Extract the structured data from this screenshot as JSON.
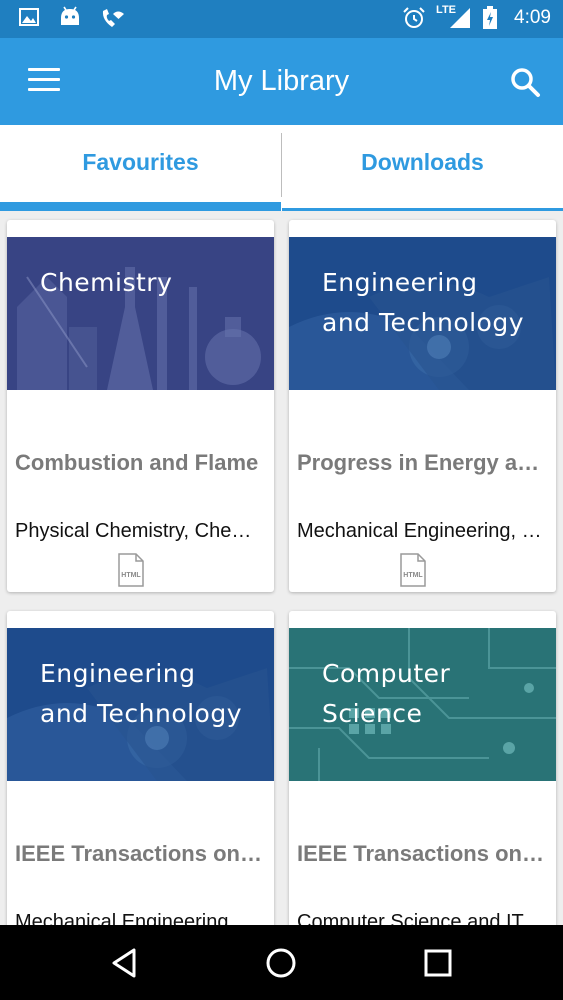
{
  "status_bar": {
    "time": "4:09",
    "network": "LTE",
    "left_icons": [
      "image-icon",
      "android-icon",
      "wifi-call-icon"
    ],
    "right_icons": [
      "alarm-icon",
      "signal-icon",
      "battery-icon"
    ]
  },
  "app_bar": {
    "title": "My Library",
    "menu_icon": "menu-icon",
    "search_icon": "search-icon"
  },
  "tabs": [
    {
      "label": "Favourites",
      "selected": true
    },
    {
      "label": "Downloads",
      "selected": false
    }
  ],
  "cards": [
    {
      "image_label_lines": [
        "Chemistry"
      ],
      "title": "Combustion and Flame",
      "subtitle": "Physical Chemistry, Chemical Engineering",
      "format_icon": "html-file-icon",
      "format_label": "HTML",
      "theme_color": "#3a4a8a"
    },
    {
      "image_label_lines": [
        "Engineering",
        "and Technology"
      ],
      "title": "Progress in Energy and Combustion Science",
      "subtitle": "Mechanical Engineering, Energy",
      "format_icon": "html-file-icon",
      "format_label": "HTML",
      "theme_color": "#1f4a8a"
    },
    {
      "image_label_lines": [
        "Engineering",
        "and Technology"
      ],
      "title": "IEEE Transactions on Industrial Electronics",
      "subtitle": "Mechanical Engineering, Electrical",
      "theme_color": "#1f4a8a"
    },
    {
      "image_label_lines": [
        "Computer",
        "Science"
      ],
      "title": "IEEE Transactions on Computers",
      "subtitle": "Computer Science and IT",
      "theme_color": "#2f7d80"
    }
  ],
  "nav_bar": [
    "back-icon",
    "home-icon",
    "recents-icon"
  ],
  "colors": {
    "status_bar": "#1f7fc0",
    "app_bar": "#2f9ae0",
    "accent": "#2f9ae0"
  }
}
